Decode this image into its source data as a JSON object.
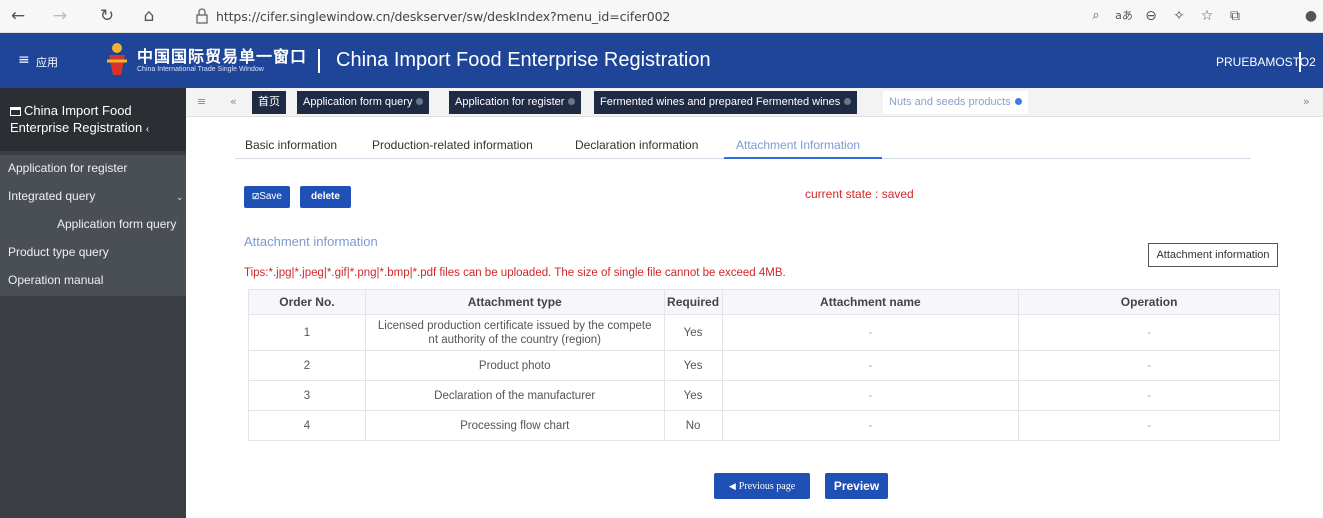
{
  "browser": {
    "url": "https://cifer.singlewindow.cn/deskserver/sw/deskIndex?menu_id=cifer002"
  },
  "header": {
    "menu_label": "应用",
    "brand_cn": "中国国际贸易单一窗口",
    "brand_en": "China International Trade Single Window",
    "title": "China Import Food Enterprise Registration",
    "username": "PRUEBAMOSTO2"
  },
  "sidebar": {
    "title": "China Import Food Enterprise Registration",
    "items": [
      {
        "label": "Application for register"
      },
      {
        "label": "Integrated query"
      },
      {
        "label": "Application form query"
      },
      {
        "label": "Product type query"
      },
      {
        "label": "Operation manual"
      }
    ]
  },
  "tabs": [
    {
      "label": "首页"
    },
    {
      "label": "Application form query"
    },
    {
      "label": "Application for register"
    },
    {
      "label": "Fermented wines and prepared Fermented wines"
    },
    {
      "label": "Nuts and seeds products"
    }
  ],
  "subtabs": [
    {
      "label": "Basic information"
    },
    {
      "label": "Production-related information"
    },
    {
      "label": "Declaration information"
    },
    {
      "label": "Attachment Information"
    }
  ],
  "toolbar": {
    "save_label": "Save",
    "delete_label": "delete",
    "state_text": "current state : saved"
  },
  "attachments": {
    "section_title": "Attachment information",
    "button_label": "Attachment information",
    "tips": "Tips:*.jpg|*.jpeg|*.gif|*.png|*.bmp|*.pdf files can be uploaded. The size of single file cannot be exceed 4MB.",
    "columns": [
      "Order No.",
      "Attachment type",
      "Required",
      "Attachment name",
      "Operation"
    ],
    "rows": [
      {
        "order": "1",
        "type_line1": "Licensed production certificate issued by the compete",
        "type_line2": "nt authority of the country (region)",
        "required": "Yes",
        "name": "-",
        "operation": "-"
      },
      {
        "order": "2",
        "type_line1": "Product photo",
        "type_line2": "",
        "required": "Yes",
        "name": "-",
        "operation": "-"
      },
      {
        "order": "3",
        "type_line1": "Declaration of the manufacturer",
        "type_line2": "",
        "required": "Yes",
        "name": "-",
        "operation": "-"
      },
      {
        "order": "4",
        "type_line1": "Processing flow chart",
        "type_line2": "",
        "required": "No",
        "name": "-",
        "operation": "-"
      }
    ]
  },
  "footer": {
    "previous_label": "Previous page",
    "preview_label": "Preview"
  }
}
